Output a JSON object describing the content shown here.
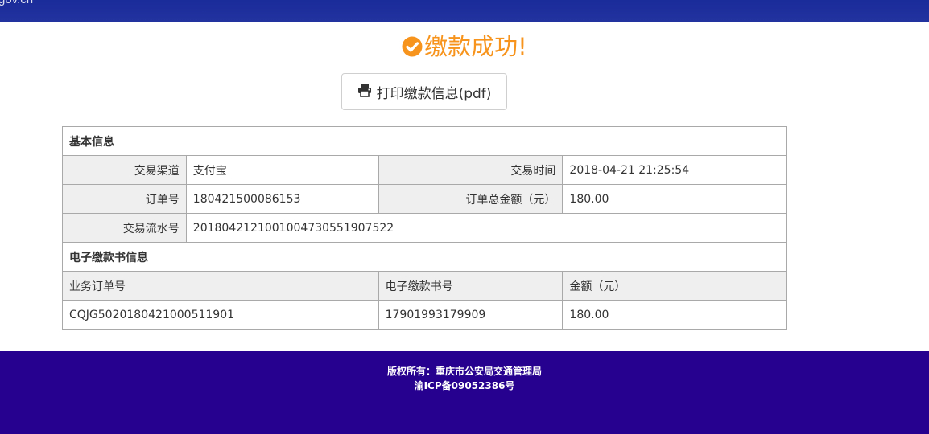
{
  "header": {
    "site_text": "gov.cn"
  },
  "success": {
    "title": "缴款成功!"
  },
  "print_button": {
    "label": "打印缴款信息(pdf)"
  },
  "basic_info": {
    "section_title": "基本信息",
    "channel_label": "交易渠道",
    "channel_value": "支付宝",
    "time_label": "交易时间",
    "time_value": "2018-04-21 21:25:54",
    "order_no_label": "订单号",
    "order_no_value": "180421500086153",
    "total_label": "订单总金额（元）",
    "total_value": "180.00",
    "serial_label": "交易流水号",
    "serial_value": "2018042121001004730551907522"
  },
  "e_payment": {
    "section_title": "电子缴款书信息",
    "columns": [
      "业务订单号",
      "电子缴款书号",
      "金额（元）"
    ],
    "rows": [
      [
        "CQJG5020180421000511901",
        "17901993179909",
        "180.00"
      ]
    ]
  },
  "footer": {
    "copyright": "版权所有：重庆市公安局交通管理局",
    "icp": "渝ICP备09052386号"
  },
  "colors": {
    "success_orange": "#f7941d",
    "footer_bg": "#26008f",
    "topbar_bg": "#1f2f9d"
  },
  "icons": {
    "title_icon": "check-circle-icon",
    "button_icon": "printer-icon"
  }
}
